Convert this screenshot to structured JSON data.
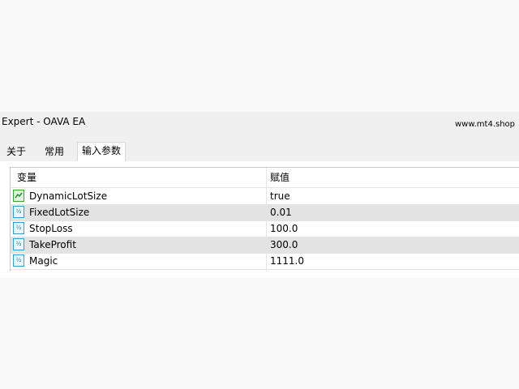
{
  "window": {
    "title": "Expert - OAVA EA",
    "watermark": "www.mt4.shop"
  },
  "tabs": [
    {
      "label": "关于",
      "active": false
    },
    {
      "label": "常用",
      "active": false
    },
    {
      "label": "输入参数",
      "active": true
    }
  ],
  "table": {
    "headers": {
      "variable": "变量",
      "value": "赋值"
    },
    "rows": [
      {
        "icon": "boolean-icon",
        "name": "DynamicLotSize",
        "value": "true"
      },
      {
        "icon": "double-value-icon",
        "name": "FixedLotSize",
        "value": "0.01"
      },
      {
        "icon": "double-value-icon",
        "name": "StopLoss",
        "value": "100.0"
      },
      {
        "icon": "double-value-icon",
        "name": "TakeProfit",
        "value": "300.0"
      },
      {
        "icon": "double-value-icon",
        "name": "Magic",
        "value": "1111.0"
      }
    ]
  },
  "colors": {
    "dialog_background": "#f0f0f0",
    "alternate_row": "#e3e3e3",
    "boolean_icon": "#3ba33b",
    "number_icon": "#3b9cc4"
  }
}
